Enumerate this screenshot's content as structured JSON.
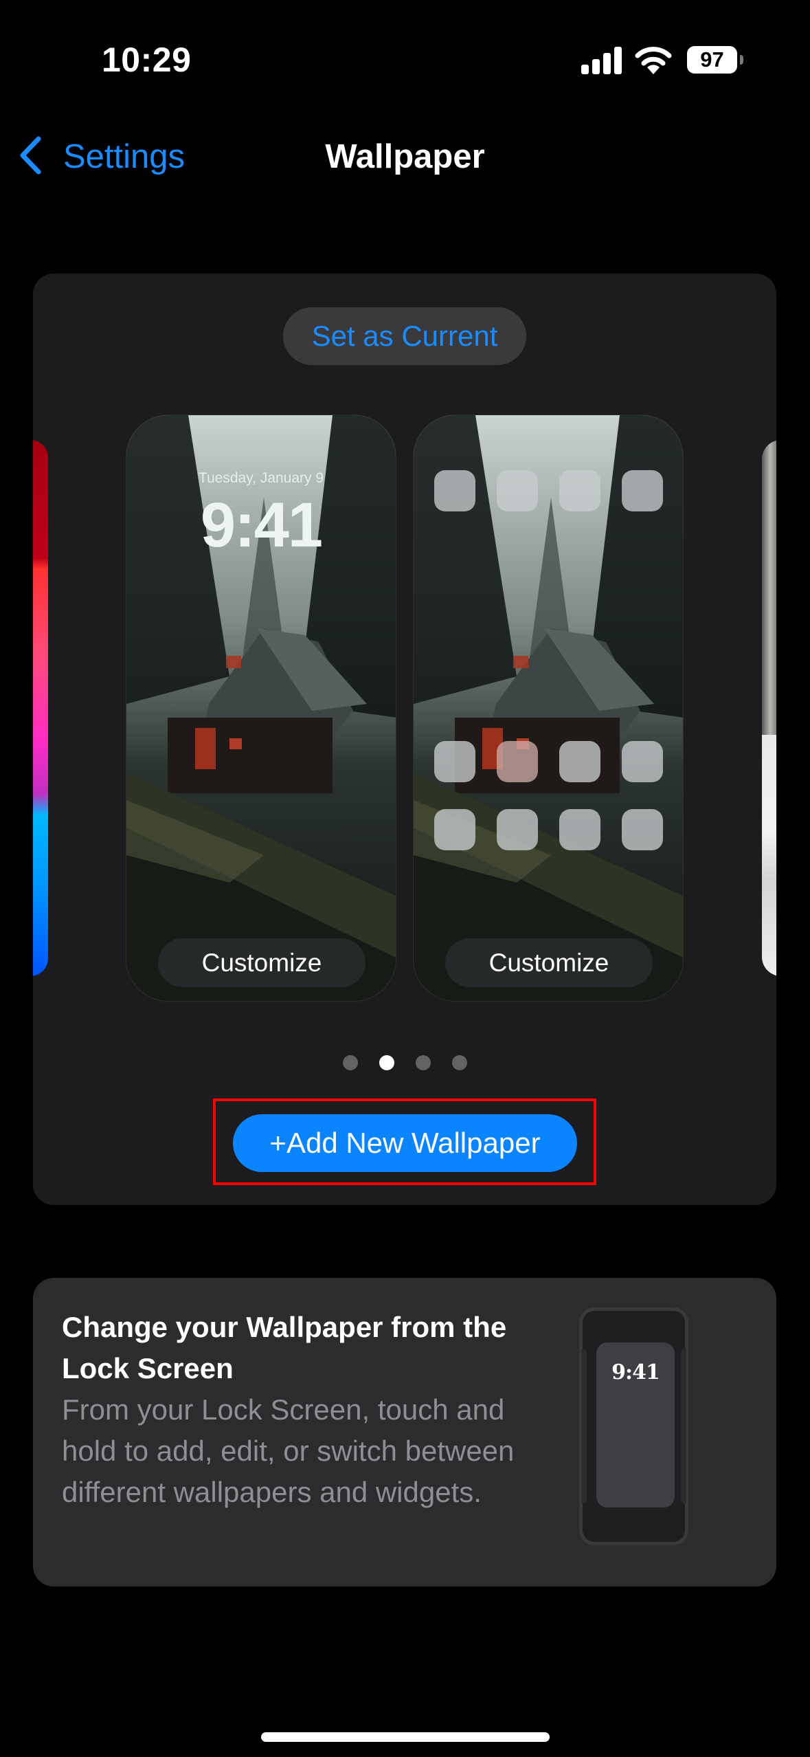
{
  "status_bar": {
    "time": "10:29",
    "battery_level": "97",
    "signal_icon": "cellular-signal-icon",
    "wifi_icon": "wifi-icon",
    "battery_icon": "battery-icon"
  },
  "nav": {
    "back_label": "Settings",
    "back_icon": "chevron-left-icon",
    "title": "Wallpaper"
  },
  "wallpaper_card": {
    "set_current_label": "Set as Current",
    "lock_preview": {
      "date": "Tuesday, January 9",
      "time": "9:41",
      "customize_label": "Customize"
    },
    "home_preview": {
      "customize_label": "Customize",
      "app_icon_rows": 3,
      "app_icons_per_row": 4
    },
    "page_indicator": {
      "total": 4,
      "current": 2
    },
    "add_button_label": "+Add New Wallpaper",
    "accent_color": "#0a84ff",
    "highlight_color": "#ff0000"
  },
  "info_card": {
    "title": "Change your Wallpaper from the Lock Screen",
    "body": "From your Lock Screen, touch and hold to add, edit, or switch between different wallpapers and widgets.",
    "illustration_time": "9:41"
  }
}
